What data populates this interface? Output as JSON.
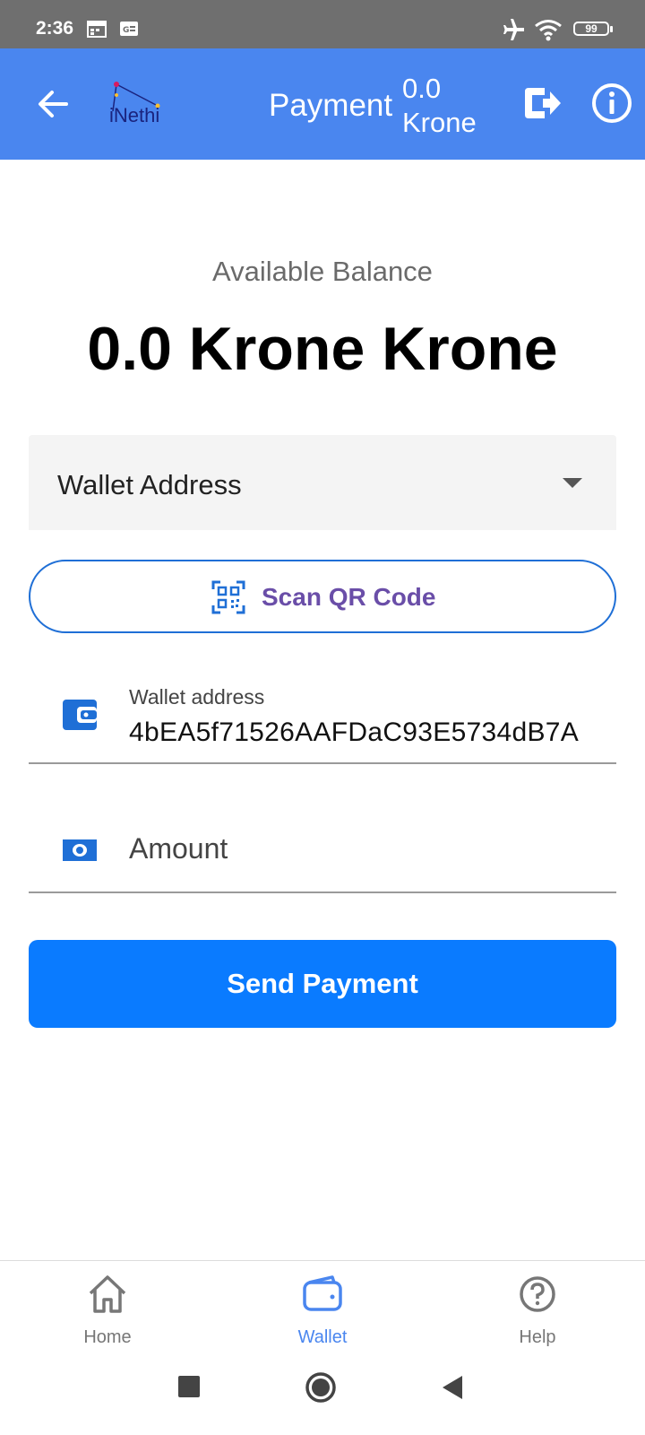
{
  "status_bar": {
    "time": "2:36",
    "battery": "99"
  },
  "app_bar": {
    "title": "Payment",
    "balance_line1": "0.0",
    "balance_line2": "Krone",
    "logo_text": "iNethi",
    "colors": {
      "background": "#4a86ef"
    }
  },
  "balance": {
    "label": "Available Balance",
    "value": "0.0 Krone Krone"
  },
  "dropdown": {
    "selected": "Wallet Address"
  },
  "scan_button": {
    "label": "Scan QR Code"
  },
  "wallet_field": {
    "label": "Wallet address",
    "value": "4bEA5f71526AAFDaC93E5734dB7A"
  },
  "amount_field": {
    "placeholder": "Amount"
  },
  "send_button": {
    "label": "Send Payment",
    "color": "#0a7bff"
  },
  "bottom_nav": {
    "items": [
      {
        "label": "Home",
        "icon": "home-icon",
        "active": false
      },
      {
        "label": "Wallet",
        "icon": "wallet-icon",
        "active": true
      },
      {
        "label": "Help",
        "icon": "help-icon",
        "active": false
      }
    ]
  }
}
